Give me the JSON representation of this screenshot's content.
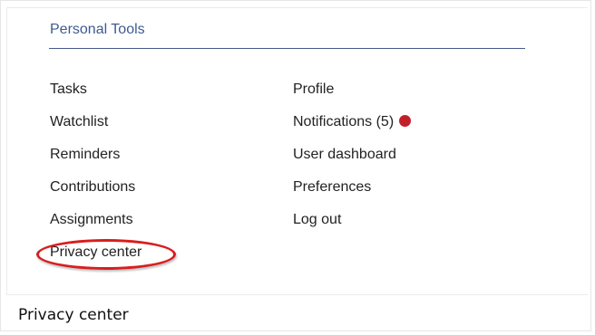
{
  "panel": {
    "title": "Personal Tools"
  },
  "menu": {
    "left": [
      {
        "label": "Tasks"
      },
      {
        "label": "Watchlist"
      },
      {
        "label": "Reminders"
      },
      {
        "label": "Contributions"
      },
      {
        "label": "Assignments"
      },
      {
        "label": "Privacy center"
      }
    ],
    "right": [
      {
        "label": "Profile"
      },
      {
        "label": "Notifications (5)"
      },
      {
        "label": "User dashboard"
      },
      {
        "label": "Preferences"
      },
      {
        "label": "Log out"
      }
    ]
  },
  "notification_dot_color": "#c21f2a",
  "highlight_color": "#d81e1e",
  "caption": "Privacy center"
}
